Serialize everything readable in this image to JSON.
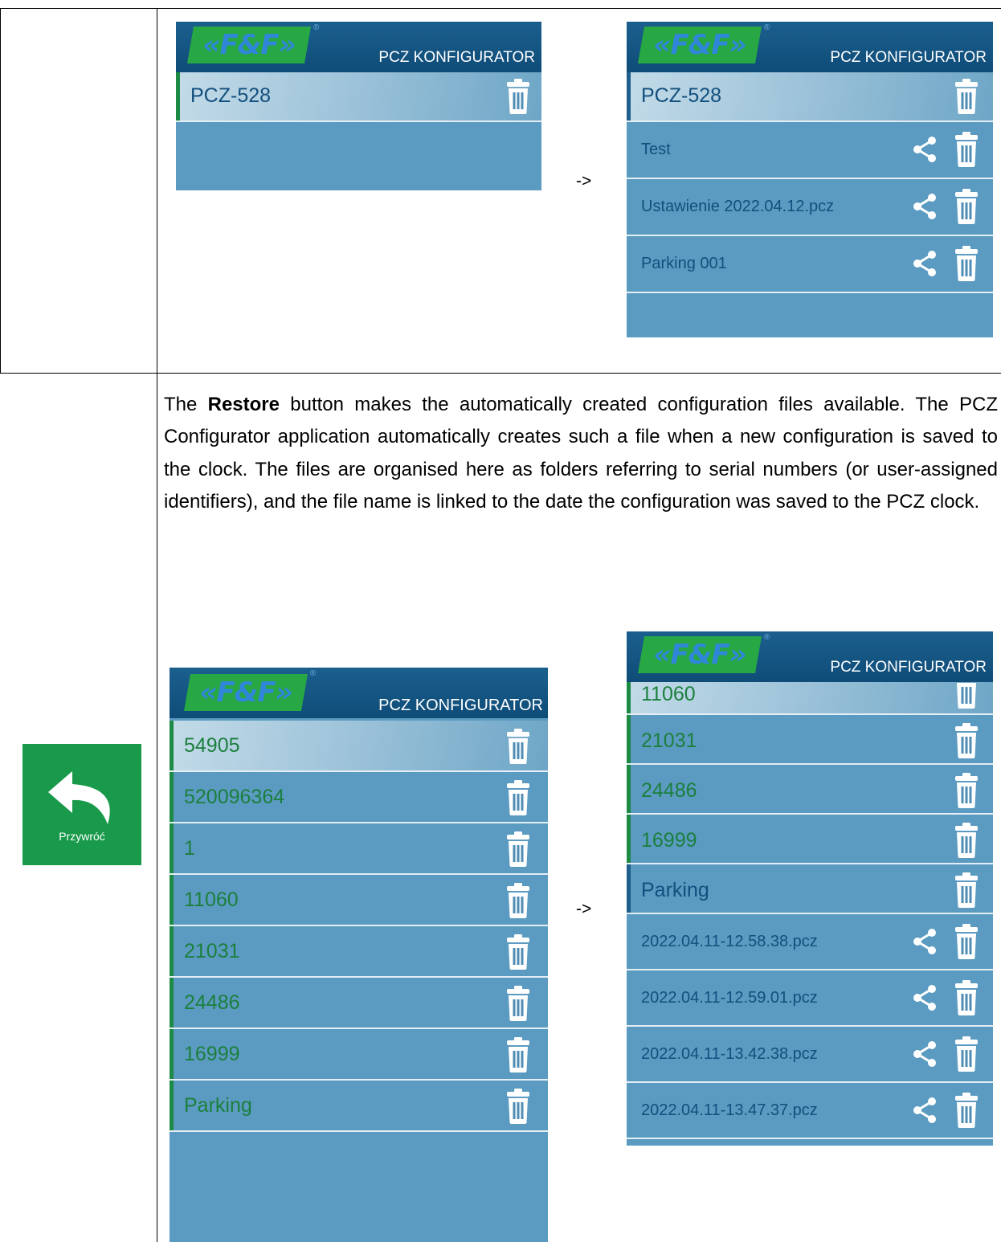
{
  "arrow": "->",
  "app": {
    "logo_text": "«F&F»",
    "logo_reg": "®",
    "title": "PCZ KONFIGURATOR"
  },
  "screen1": {
    "rows": [
      {
        "label": "PCZ-528"
      }
    ]
  },
  "screen2": {
    "rows": [
      {
        "label": "PCZ-528"
      },
      {
        "label": "Test"
      },
      {
        "label": "Ustawienie 2022.04.12.pcz"
      },
      {
        "label": "Parking 001"
      }
    ]
  },
  "description": {
    "before": "The ",
    "bold": "Restore",
    "after": " button makes the automatically created configuration files available. The PCZ Configurator application automatically creates such a file when a new configuration is saved to the clock. The files are organised here as folders referring to serial numbers (or user-assigned identifiers), and the file name is linked to the date the configuration was saved to the PCZ clock."
  },
  "restore_button": {
    "label": "Przywróć",
    "icon": "undo-arrow-icon",
    "color": "#199a4b"
  },
  "screen3": {
    "rows": [
      {
        "label": "54905"
      },
      {
        "label": "520096364"
      },
      {
        "label": "1"
      },
      {
        "label": "11060"
      },
      {
        "label": "21031"
      },
      {
        "label": "24486"
      },
      {
        "label": "16999"
      },
      {
        "label": "Parking"
      }
    ]
  },
  "screen4": {
    "rows": [
      {
        "label": "11060"
      },
      {
        "label": "21031"
      },
      {
        "label": "24486"
      },
      {
        "label": "16999"
      },
      {
        "label": "Parking"
      },
      {
        "label": "2022.04.11-12.58.38.pcz"
      },
      {
        "label": "2022.04.11-12.59.01.pcz"
      },
      {
        "label": "2022.04.11-13.42.38.pcz"
      },
      {
        "label": "2022.04.11-13.47.37.pcz"
      }
    ]
  },
  "colors": {
    "header": "#0f4c78",
    "list_bg": "#5b9bc1",
    "label_green": "#1c7f3d",
    "label_blue": "#124f7e",
    "accent_green": "#1d8b43"
  }
}
